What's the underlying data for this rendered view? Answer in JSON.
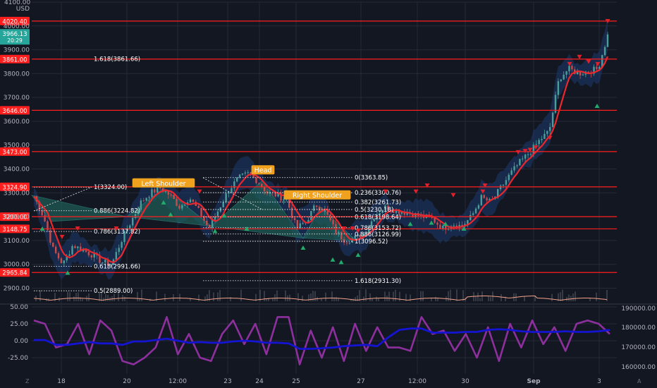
{
  "header": {
    "price_top": "4100.00",
    "currency": "USD"
  },
  "colors": {
    "background": "#131722",
    "grid": "#262a36",
    "level_line": "#ff1e1e",
    "price_label_bg": "#ff1e1e",
    "current_price_bg": "#26a69a",
    "ma_line": "#e8272f",
    "band_fill": "#1e3a6e",
    "pattern_fill": "#1f5f57",
    "candle_up": "#4a9e9a",
    "candle_down": "#c94c4c",
    "annotation_bg": "#f0a21e",
    "fib_text": "#ffffff",
    "osc_purple": "#8e2f9e",
    "osc_blue": "#1414d2",
    "axis_text": "#b2b5be",
    "volume_line": "#f5a38a"
  },
  "current_price": {
    "value": "3966.13",
    "countdown": "20:29"
  },
  "chart_data": {
    "type": "candlestick",
    "y_axis": {
      "min": 2860,
      "max": 4100,
      "ticks": [
        "4100.00",
        "4000.00",
        "3900.00",
        "3800.00",
        "3700.00",
        "3600.00",
        "3500.00",
        "3400.00",
        "3300.00",
        "3200.00",
        "3100.00",
        "3000.00",
        "2900.00"
      ]
    },
    "x_axis": {
      "ticks": [
        "18",
        "20",
        "12:00",
        "23",
        "24",
        "25",
        "27",
        "12:00",
        "30",
        "Sep",
        "3"
      ]
    },
    "horizontal_levels": [
      {
        "value": 4020.4,
        "label": "4020.40"
      },
      {
        "value": 3861.0,
        "label": "3861.00"
      },
      {
        "value": 3646.0,
        "label": "3646.00"
      },
      {
        "value": 3473.0,
        "label": "3473.00"
      },
      {
        "value": 3324.9,
        "label": "3324.90"
      },
      {
        "value": 3200.0,
        "label": "3200.00"
      },
      {
        "value": 3148.75,
        "label": "3148.75"
      },
      {
        "value": 2965.84,
        "label": "2965.84"
      }
    ],
    "fib_left": [
      {
        "price": 3861.66,
        "label": "1.618(3861.66)"
      },
      {
        "price": 3324.0,
        "label": "1(3324.00)"
      },
      {
        "price": 3224.82,
        "label": "0.886(3224.82)"
      },
      {
        "price": 3137.82,
        "label": "0.786(3137.82)"
      },
      {
        "price": 2991.66,
        "label": "0.618(2991.66)"
      },
      {
        "price": 2889.0,
        "label": "0.5(2889.00)"
      }
    ],
    "fib_right": [
      {
        "price": 3363.85,
        "label": "0(3363.85)"
      },
      {
        "price": 3300.76,
        "label": "0.236(3300.76)"
      },
      {
        "price": 3261.73,
        "label": "0.382(3261.73)"
      },
      {
        "price": 3230.18,
        "label": "0.5(3230.18)"
      },
      {
        "price": 3198.64,
        "label": "0.618(3198.64)"
      },
      {
        "price": 3153.72,
        "label": "0.786(3153.72)"
      },
      {
        "price": 3126.99,
        "label": "0.886(3126.99)"
      },
      {
        "price": 3096.52,
        "label": "1(3096.52)"
      },
      {
        "price": 2931.3,
        "label": "1.618(2931.30)"
      }
    ],
    "annotations": [
      {
        "label": "Left Shoulder",
        "price": 3340
      },
      {
        "label": "Head",
        "price": 3395
      },
      {
        "label": "Right Shoulder",
        "price": 3290
      }
    ],
    "price_path": [
      3285,
      3200,
      3060,
      3000,
      3080,
      3060,
      3040,
      3010,
      3000,
      3100,
      3180,
      3260,
      3300,
      3320,
      3290,
      3240,
      3280,
      3220,
      3150,
      3230,
      3310,
      3360,
      3380,
      3350,
      3300,
      3290,
      3270,
      3150,
      3180,
      3250,
      3220,
      3140,
      3100,
      3110,
      3130,
      3200,
      3240,
      3230,
      3220,
      3210,
      3200,
      3190,
      3150,
      3170,
      3160,
      3200,
      3280,
      3260,
      3320,
      3380,
      3430,
      3470,
      3520,
      3560,
      3780,
      3820,
      3800,
      3810,
      3820,
      3960
    ],
    "oscillator": {
      "y_ticks": [
        "50.00",
        "25.00",
        "0.00",
        "-25.00"
      ],
      "right_ticks": [
        "190000.00",
        "180000.00",
        "170000.00",
        "160000.00"
      ],
      "purple": [
        30,
        25,
        -10,
        -5,
        25,
        -20,
        30,
        15,
        -30,
        -35,
        -25,
        -10,
        35,
        -20,
        10,
        -25,
        -30,
        10,
        30,
        -5,
        25,
        -20,
        35,
        35,
        -35,
        15,
        -25,
        20,
        -30,
        25,
        -15,
        20,
        -10,
        -10,
        -15,
        35,
        10,
        15,
        -15,
        10,
        -25,
        20,
        -30,
        25,
        -10,
        30,
        -5,
        20,
        -15,
        25,
        30,
        25,
        10
      ],
      "blue": [
        1,
        1,
        -6,
        -6,
        -4,
        -2,
        -4,
        -4,
        -6,
        -1,
        -1,
        1,
        3,
        0,
        -3,
        -2,
        -3,
        -3,
        -1,
        0,
        -1,
        -3,
        -3,
        -4,
        -12,
        -12,
        -11,
        -10,
        -8,
        -7,
        -6,
        -8,
        5,
        16,
        18,
        18,
        12,
        12,
        12,
        13,
        13,
        16,
        17,
        16,
        14,
        13,
        13,
        13,
        14,
        13,
        13,
        14,
        16
      ]
    },
    "volume_right_label": "190000.00"
  }
}
